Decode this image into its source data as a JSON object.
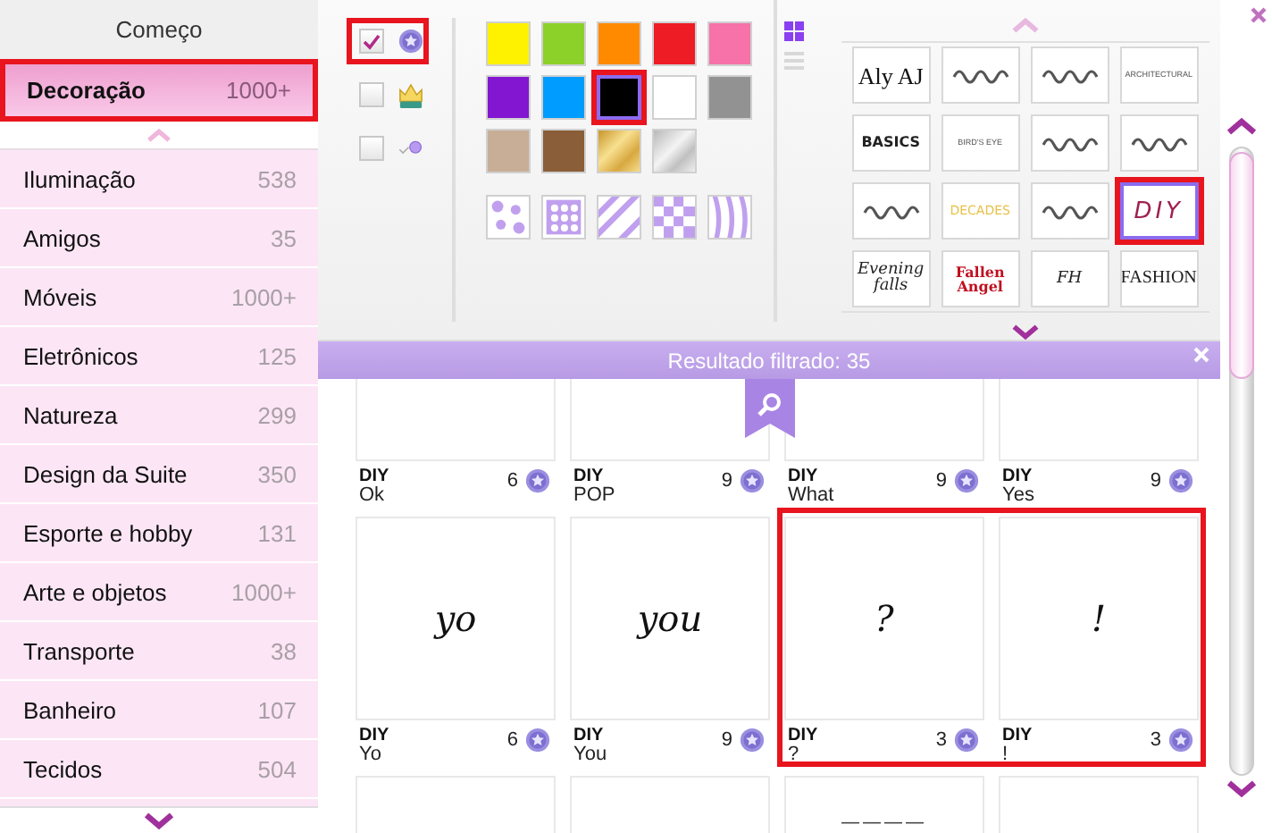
{
  "sidebar": {
    "home": "Começo",
    "current": {
      "label": "Decoração",
      "count": "1000+",
      "selected": true,
      "highlighted": true
    },
    "items": [
      {
        "label": "Iluminação",
        "count": "538"
      },
      {
        "label": "Amigos",
        "count": "35"
      },
      {
        "label": "Móveis",
        "count": "1000+"
      },
      {
        "label": "Eletrônicos",
        "count": "125"
      },
      {
        "label": "Natureza",
        "count": "299"
      },
      {
        "label": "Design da Suite",
        "count": "350"
      },
      {
        "label": "Esporte e hobby",
        "count": "131"
      },
      {
        "label": "Arte e objetos",
        "count": "1000+"
      },
      {
        "label": "Transporte",
        "count": "38"
      },
      {
        "label": "Banheiro",
        "count": "107"
      },
      {
        "label": "Tecidos",
        "count": "504"
      }
    ]
  },
  "filters": {
    "options": [
      {
        "kind": "coin",
        "checked": true,
        "highlighted": true
      },
      {
        "kind": "crown",
        "checked": false,
        "highlighted": false
      },
      {
        "kind": "owned",
        "checked": false,
        "highlighted": false
      }
    ],
    "colors": [
      {
        "kind": "solid",
        "color": "#fff200",
        "selected": false,
        "highlighted": false
      },
      {
        "kind": "solid",
        "color": "#8cd02a",
        "selected": false,
        "highlighted": false
      },
      {
        "kind": "solid",
        "color": "#ff8a00",
        "selected": false,
        "highlighted": false
      },
      {
        "kind": "solid",
        "color": "#ee1c25",
        "selected": false,
        "highlighted": false
      },
      {
        "kind": "solid",
        "color": "#f672a8",
        "selected": false,
        "highlighted": false
      },
      {
        "kind": "solid",
        "color": "#8316d0",
        "selected": false,
        "highlighted": false
      },
      {
        "kind": "solid",
        "color": "#009cff",
        "selected": false,
        "highlighted": false
      },
      {
        "kind": "solid",
        "color": "#000000",
        "selected": true,
        "highlighted": true
      },
      {
        "kind": "solid",
        "color": "#ffffff",
        "selected": false,
        "highlighted": false
      },
      {
        "kind": "solid",
        "color": "#929292",
        "selected": false,
        "highlighted": false
      },
      {
        "kind": "solid",
        "color": "#c8ae96",
        "selected": false,
        "highlighted": false
      },
      {
        "kind": "solid",
        "color": "#8a5e38",
        "selected": false,
        "highlighted": false
      },
      {
        "kind": "gold",
        "selected": false,
        "highlighted": false
      },
      {
        "kind": "silver",
        "selected": false,
        "highlighted": false
      }
    ],
    "patterns": [
      {
        "kind": "flowers"
      },
      {
        "kind": "dots"
      },
      {
        "kind": "stripes"
      },
      {
        "kind": "checker"
      },
      {
        "kind": "zebra"
      }
    ],
    "views": [
      {
        "kind": "grid",
        "selected": true
      },
      {
        "kind": "list",
        "selected": false
      }
    ],
    "fonts": [
      {
        "kind": "serif",
        "sample": "Aly AJ",
        "selected": false,
        "highlighted": false
      },
      {
        "kind": "scribble",
        "selected": false,
        "highlighted": false
      },
      {
        "kind": "scribble",
        "selected": false,
        "highlighted": false
      },
      {
        "kind": "thin",
        "sample": "ARCHITECTURAL",
        "selected": false,
        "highlighted": false
      },
      {
        "kind": "bold",
        "sample": "BASICS",
        "selected": false,
        "highlighted": false
      },
      {
        "kind": "thin",
        "sample": "BIRD'S EYE",
        "selected": false,
        "highlighted": false
      },
      {
        "kind": "scribble",
        "selected": false,
        "highlighted": false
      },
      {
        "kind": "scribble",
        "selected": false,
        "highlighted": false
      },
      {
        "kind": "scribble",
        "selected": false,
        "highlighted": false
      },
      {
        "kind": "gold",
        "sample": "DECADES",
        "selected": false,
        "highlighted": false
      },
      {
        "kind": "scribble",
        "selected": false,
        "highlighted": false
      },
      {
        "kind": "italic",
        "sample": "DIY",
        "selected": true,
        "highlighted": true
      },
      {
        "kind": "script",
        "sample": "Evening falls",
        "selected": false,
        "highlighted": false
      },
      {
        "kind": "gothic",
        "sample": "Fallen Angel",
        "selected": false,
        "highlighted": false
      },
      {
        "kind": "script",
        "sample": "FH",
        "selected": false,
        "highlighted": false
      },
      {
        "kind": "condensed",
        "sample": "FASHION",
        "selected": false,
        "highlighted": false
      }
    ]
  },
  "results": {
    "title": "Resultado filtrado: 35",
    "items": [
      {
        "tag": "DIY",
        "name": "Ok",
        "price": "6",
        "highlighted": false
      },
      {
        "tag": "DIY",
        "name": "POP",
        "price": "9",
        "highlighted": false
      },
      {
        "tag": "DIY",
        "name": "What",
        "price": "9",
        "highlighted": false
      },
      {
        "tag": "DIY",
        "name": "Yes",
        "price": "9",
        "highlighted": false
      },
      {
        "tag": "DIY",
        "name": "Yo",
        "price": "6",
        "preview": "yo",
        "highlighted": false
      },
      {
        "tag": "DIY",
        "name": "You",
        "price": "9",
        "preview": "you",
        "highlighted": false
      },
      {
        "tag": "DIY",
        "name": "?",
        "price": "3",
        "preview": "?",
        "highlighted": true
      },
      {
        "tag": "DIY",
        "name": "!",
        "price": "3",
        "preview": "!",
        "highlighted": true
      },
      {
        "highlighted": false
      },
      {
        "highlighted": false
      },
      {
        "preview": "____",
        "highlighted": false
      },
      {
        "highlighted": false
      }
    ]
  }
}
